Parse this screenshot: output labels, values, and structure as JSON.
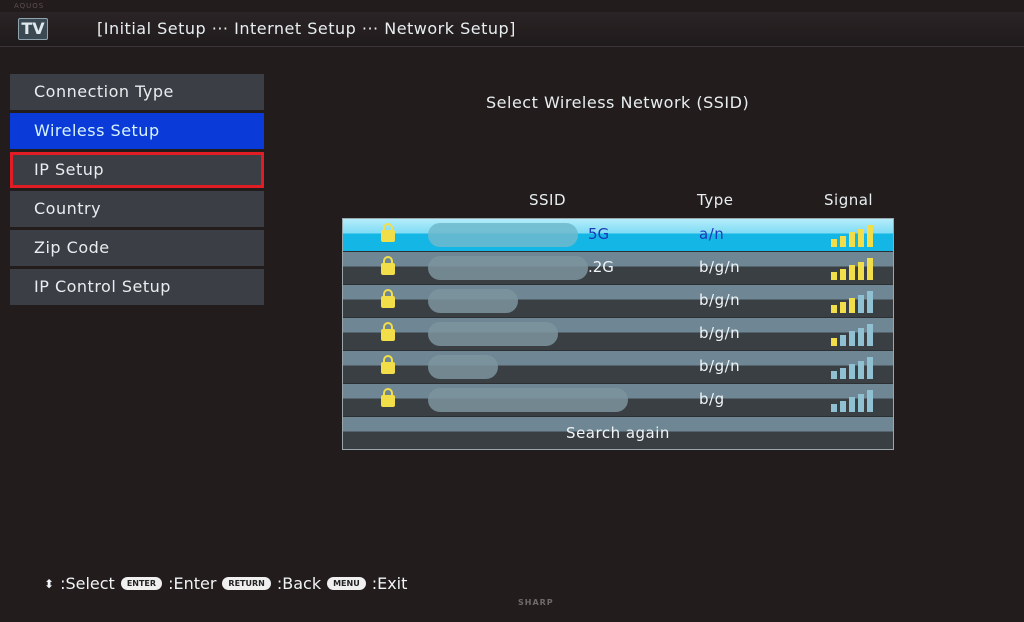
{
  "bezel_label": "AQUOS",
  "header": {
    "logo": "TV",
    "breadcrumb": "[Initial Setup ··· Internet Setup ··· Network Setup]"
  },
  "menu": {
    "items": [
      {
        "label": "Connection Type",
        "state": "normal"
      },
      {
        "label": "Wireless Setup",
        "state": "active"
      },
      {
        "label": "IP Setup",
        "state": "highlighted"
      },
      {
        "label": "Country",
        "state": "normal"
      },
      {
        "label": "Zip Code",
        "state": "normal"
      },
      {
        "label": "IP Control Setup",
        "state": "normal"
      }
    ]
  },
  "panel": {
    "title": "Select Wireless Network (SSID)",
    "columns": {
      "ssid": "SSID",
      "type": "Type",
      "signal": "Signal"
    },
    "networks": [
      {
        "ssid_visible": "5G",
        "type": "a/n",
        "signal": 5,
        "locked": true,
        "selected": true
      },
      {
        "ssid_visible": ".2G",
        "type": "b/g/n",
        "signal": 5,
        "locked": true,
        "selected": false
      },
      {
        "ssid_visible": "",
        "type": "b/g/n",
        "signal": 3,
        "locked": true,
        "selected": false
      },
      {
        "ssid_visible": "",
        "type": "b/g/n",
        "signal": 1,
        "locked": true,
        "selected": false
      },
      {
        "ssid_visible": "",
        "type": "b/g/n",
        "signal": 0,
        "locked": true,
        "selected": false
      },
      {
        "ssid_visible": "",
        "type": "b/g",
        "signal": 0,
        "locked": true,
        "selected": false
      }
    ],
    "signal_max": 5,
    "search_again": "Search again"
  },
  "footer": {
    "select_icon": "up-down-arrow",
    "select": ":Select",
    "enter_key": "ENTER",
    "enter": ":Enter",
    "return_key": "RETURN",
    "back": ":Back",
    "menu_key": "MENU",
    "exit": ":Exit"
  },
  "brand": "SHARP",
  "colors": {
    "active": "#0a3bd8",
    "highlight_border": "#e01c24",
    "selected_row": "#14b6e6",
    "signal_on": "#f2de48"
  }
}
